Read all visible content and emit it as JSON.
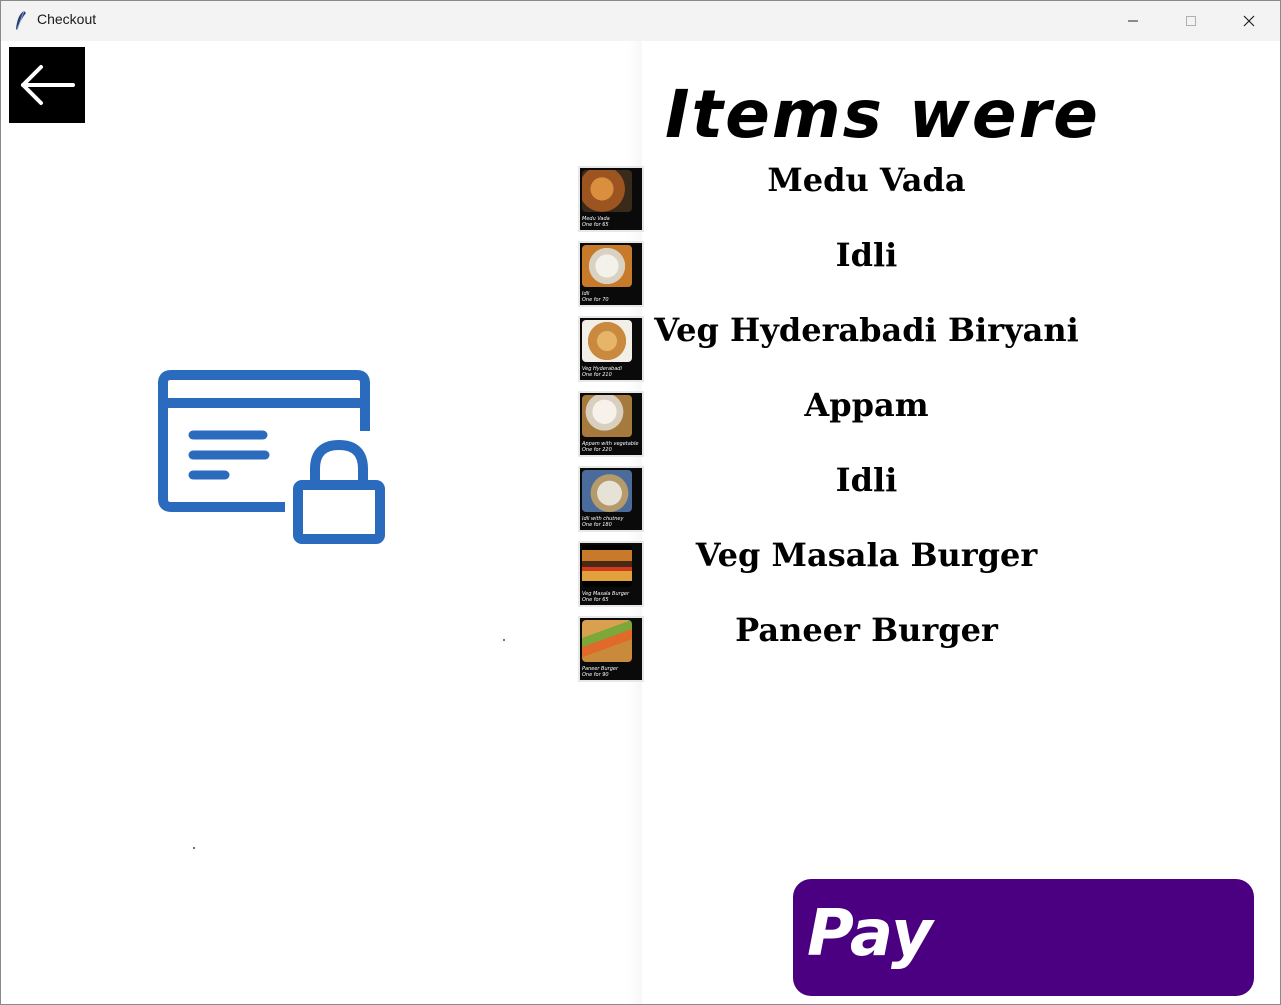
{
  "window": {
    "title": "Checkout",
    "controls": {
      "minimize": "minimize",
      "maximize": "maximize",
      "close": "close"
    }
  },
  "left_panel": {
    "back_icon": "arrow-left-icon",
    "illustration_icon": "credit-card-lock-icon",
    "accent_color": "#2b6bbd"
  },
  "order": {
    "heading": "Items were",
    "items": [
      {
        "name": "Medu Vada",
        "caption_line1": "Medu Vada",
        "caption_line2": "One for 65",
        "food_color": "#b8692a"
      },
      {
        "name": "Idli",
        "caption_line1": "Idli",
        "caption_line2": "One for 70",
        "food_color": "#e8e2d4"
      },
      {
        "name": "Veg Hyderabadi Biryani",
        "caption_line1": "Veg Hyderabadi",
        "caption_line2": "One for 210",
        "food_color": "#d7a45a"
      },
      {
        "name": "Appam",
        "caption_line1": "Appam with vegetable",
        "caption_line2": "One for 220",
        "food_color": "#efe8dc"
      },
      {
        "name": "Idli",
        "caption_line1": "Idli with chutney",
        "caption_line2": "One for 180",
        "food_color": "#cfc9b8"
      },
      {
        "name": "Veg Masala Burger",
        "caption_line1": "Veg Masala Burger",
        "caption_line2": "One for 65",
        "food_color": "#b5651d"
      },
      {
        "name": "Paneer Burger",
        "caption_line1": "Paneer Burger",
        "caption_line2": "One for 90",
        "food_color": "#c98a3c"
      }
    ]
  },
  "pay_button": {
    "label": "Pay",
    "color": "#4b0082"
  }
}
